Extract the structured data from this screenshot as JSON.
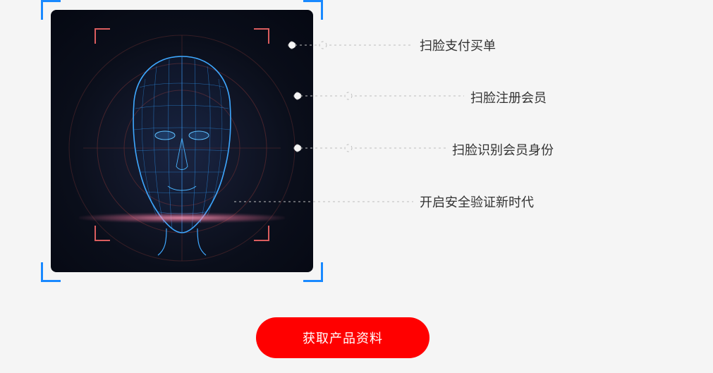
{
  "features": {
    "items": [
      "扫脸支付买单",
      "扫脸注册会员",
      "扫脸识别会员身份",
      "开启安全验证新时代"
    ]
  },
  "cta": {
    "label": "获取产品资料"
  },
  "colors": {
    "frame": "#1989ff",
    "accent": "#ff0000",
    "scan": "#ff6b9d"
  }
}
